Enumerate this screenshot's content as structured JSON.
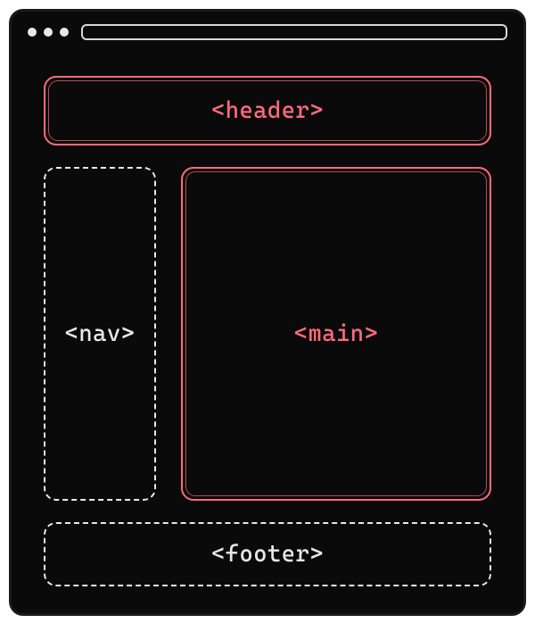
{
  "diagram": {
    "header_label": "<header>",
    "nav_label": "<nav>",
    "main_label": "<main>",
    "footer_label": "<footer>"
  },
  "colors": {
    "accent": "#ff6b7a",
    "neutral": "#e8e8e8",
    "background": "#0a0a0a"
  }
}
